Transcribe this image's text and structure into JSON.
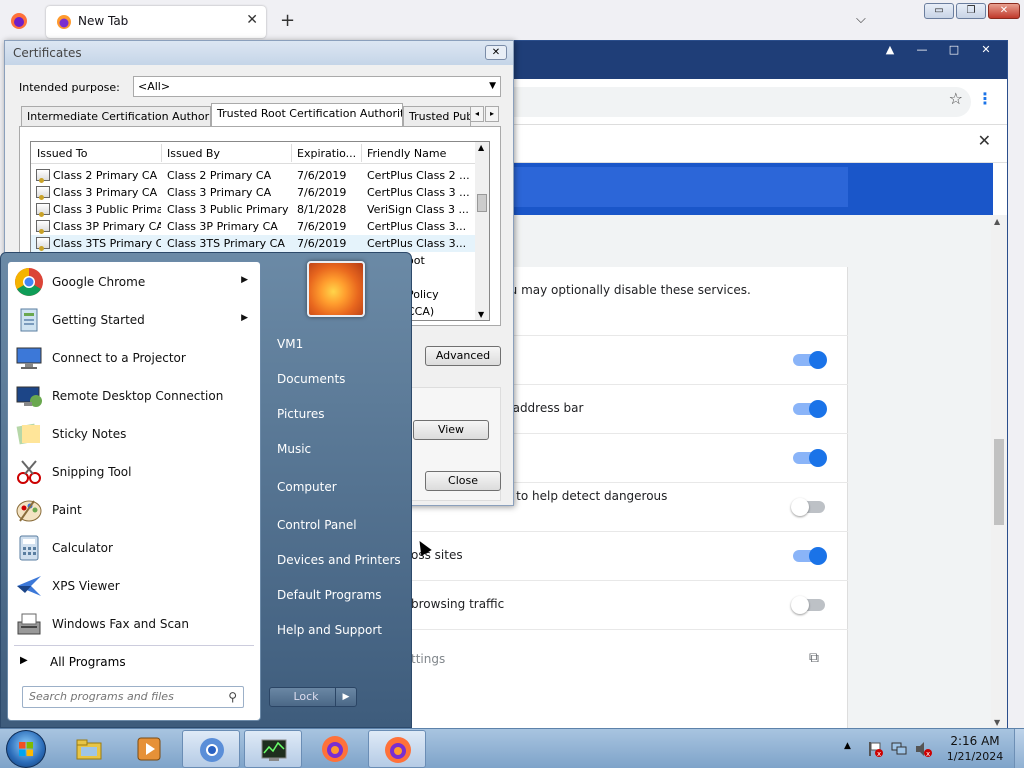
{
  "firefox": {
    "tab_title": "New Tab",
    "tab_close": "✕",
    "new_tab": "+",
    "list_tabs": "⌵",
    "win_minimize": "▭",
    "win_restore": "❐",
    "win_close": "✕"
  },
  "chrome": {
    "win_buttons": [
      "▲",
      "—",
      "□",
      "✕"
    ],
    "star": "☆",
    "menu": "⋮",
    "header_close": "✕",
    "settings_rows": [
      {
        "text": "g experience. You may optionally disable these services.",
        "toggle": null
      },
      {
        "text": "",
        "toggle": "on"
      },
      {
        "text": "RLs typed in the address bar",
        "toggle": "on"
      },
      {
        "text": "",
        "toggle": "on"
      },
      {
        "text": "ontent to Google to help detect dangerous",
        "toggle": "off"
      },
      {
        "text": "oss sites",
        "toggle": "on"
      },
      {
        "text": "browsing traffic",
        "toggle": "off"
      },
      {
        "text": "ttings",
        "toggle": null
      }
    ],
    "ext_link_icon": "⧉"
  },
  "cert_dialog": {
    "title": "Certificates",
    "close": "✕",
    "purpose_label": "Intended purpose:",
    "purpose_value": "<All>",
    "tabs": [
      "Intermediate Certification Authorities",
      "Trusted Root Certification Authorities",
      "Trusted Publi"
    ],
    "tab_scroll_left": "◂",
    "tab_scroll_right": "▸",
    "columns": [
      "Issued To",
      "Issued By",
      "Expiratio...",
      "Friendly Name"
    ],
    "rows": [
      [
        "Class 2 Primary CA",
        "Class 2 Primary CA",
        "7/6/2019",
        "CertPlus Class 2 ..."
      ],
      [
        "Class 3 Primary CA",
        "Class 3 Primary CA",
        "7/6/2019",
        "CertPlus Class 3 ..."
      ],
      [
        "Class 3 Public Prima...",
        "Class 3 Public Primary ...",
        "8/1/2028",
        "VeriSign Class 3 ..."
      ],
      [
        "Class 3P Primary CA",
        "Class 3P Primary CA",
        "7/6/2019",
        "CertPlus Class 3..."
      ],
      [
        "Class 3TS Primary CA",
        "Class 3TS Primary CA",
        "7/6/2019",
        "CertPlus Class 3..."
      ]
    ],
    "hidden_fragments": [
      "oot",
      "Policy",
      "CCA)"
    ],
    "advanced": "Advanced",
    "view": "View",
    "close_button": "Close"
  },
  "start_menu": {
    "programs": [
      {
        "label": "Google Chrome",
        "icon": "chrome-icon",
        "submenu": true
      },
      {
        "label": "Getting Started",
        "icon": "getting-started-icon",
        "submenu": true
      },
      {
        "label": "Connect to a Projector",
        "icon": "projector-icon",
        "submenu": false
      },
      {
        "label": "Remote Desktop Connection",
        "icon": "remote-desktop-icon",
        "submenu": false
      },
      {
        "label": "Sticky Notes",
        "icon": "sticky-notes-icon",
        "submenu": false
      },
      {
        "label": "Snipping Tool",
        "icon": "snipping-tool-icon",
        "submenu": false
      },
      {
        "label": "Paint",
        "icon": "paint-icon",
        "submenu": false
      },
      {
        "label": "Calculator",
        "icon": "calculator-icon",
        "submenu": false
      },
      {
        "label": "XPS Viewer",
        "icon": "xps-viewer-icon",
        "submenu": false
      },
      {
        "label": "Windows Fax and Scan",
        "icon": "fax-scan-icon",
        "submenu": false
      }
    ],
    "all_programs": "All Programs",
    "search_placeholder": "Search programs and files",
    "right_items": [
      "VM1",
      "Documents",
      "Pictures",
      "Music",
      "Computer",
      "Control Panel",
      "Devices and Printers",
      "Default Programs",
      "Help and Support"
    ],
    "lock": "Lock",
    "lock_arrow": "▶"
  },
  "taskbar": {
    "apps": [
      "explorer-icon",
      "media-player-icon",
      "chrome-icon",
      "task-manager-icon",
      "firefox-icon",
      "firefox-icon"
    ],
    "tray_up": "▲",
    "time": "2:16 AM",
    "date": "1/21/2024"
  },
  "colors": {
    "chrome_blue": "#1a56c9",
    "toggle_on": "#1a73e8",
    "taskbar": "#a8c4e0"
  }
}
